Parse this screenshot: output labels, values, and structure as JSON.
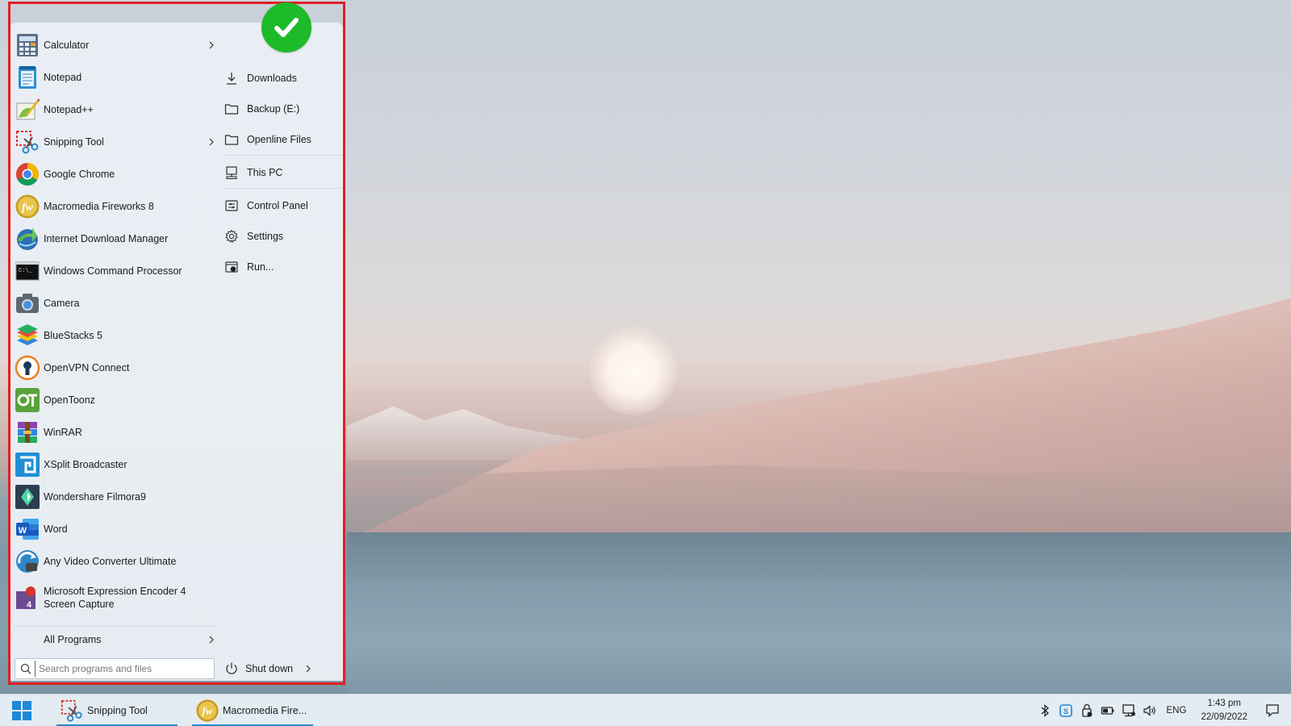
{
  "apps": [
    {
      "label": "Calculator",
      "icon": "calculator-icon",
      "has_submenu": true
    },
    {
      "label": "Notepad",
      "icon": "notepad-icon",
      "has_submenu": false
    },
    {
      "label": "Notepad++",
      "icon": "notepadpp-icon",
      "has_submenu": false
    },
    {
      "label": "Snipping Tool",
      "icon": "snipping-tool-icon",
      "has_submenu": true
    },
    {
      "label": "Google Chrome",
      "icon": "chrome-icon",
      "has_submenu": false
    },
    {
      "label": "Macromedia Fireworks 8",
      "icon": "fireworks-icon",
      "has_submenu": false
    },
    {
      "label": "Internet Download Manager",
      "icon": "idm-icon",
      "has_submenu": false
    },
    {
      "label": "Windows Command Processor",
      "icon": "cmd-icon",
      "has_submenu": false
    },
    {
      "label": "Camera",
      "icon": "camera-icon",
      "has_submenu": false
    },
    {
      "label": "BlueStacks 5",
      "icon": "bluestacks-icon",
      "has_submenu": false
    },
    {
      "label": "OpenVPN Connect",
      "icon": "openvpn-icon",
      "has_submenu": false
    },
    {
      "label": "OpenToonz",
      "icon": "opentoonz-icon",
      "has_submenu": false
    },
    {
      "label": "WinRAR",
      "icon": "winrar-icon",
      "has_submenu": false
    },
    {
      "label": "XSplit Broadcaster",
      "icon": "xsplit-icon",
      "has_submenu": false
    },
    {
      "label": "Wondershare Filmora9",
      "icon": "filmora-icon",
      "has_submenu": false
    },
    {
      "label": "Word",
      "icon": "word-icon",
      "has_submenu": false
    },
    {
      "label": "Any Video Converter Ultimate",
      "icon": "video-converter-icon",
      "has_submenu": false
    },
    {
      "label": "Microsoft Expression Encoder 4 Screen Capture",
      "icon": "expression-encoder-icon",
      "has_submenu": false
    }
  ],
  "all_programs_label": "All Programs",
  "search": {
    "placeholder": "Search programs and files",
    "value": ""
  },
  "places": [
    {
      "label": "Downloads",
      "icon": "download-icon"
    },
    {
      "label": "Backup (E:)",
      "icon": "folder-icon"
    },
    {
      "label": "Openline Files",
      "icon": "folder-icon"
    },
    {
      "label": "This PC",
      "icon": "computer-icon"
    },
    {
      "label": "Control Panel",
      "icon": "control-panel-icon"
    },
    {
      "label": "Settings",
      "icon": "gear-icon"
    },
    {
      "label": "Run...",
      "icon": "run-icon"
    }
  ],
  "shutdown_label": "Shut down",
  "taskbar": {
    "items": [
      {
        "label": "Snipping Tool",
        "icon": "snipping-tool-icon"
      },
      {
        "label": "Macromedia Fire...",
        "icon": "fireworks-icon"
      }
    ],
    "language": "ENG",
    "time": "1:43 pm",
    "date": "22/09/2022"
  },
  "colors": {
    "highlight_border": "#e31e24",
    "check_badge": "#1dbb2a",
    "taskbar_accent": "#2b88c7"
  }
}
